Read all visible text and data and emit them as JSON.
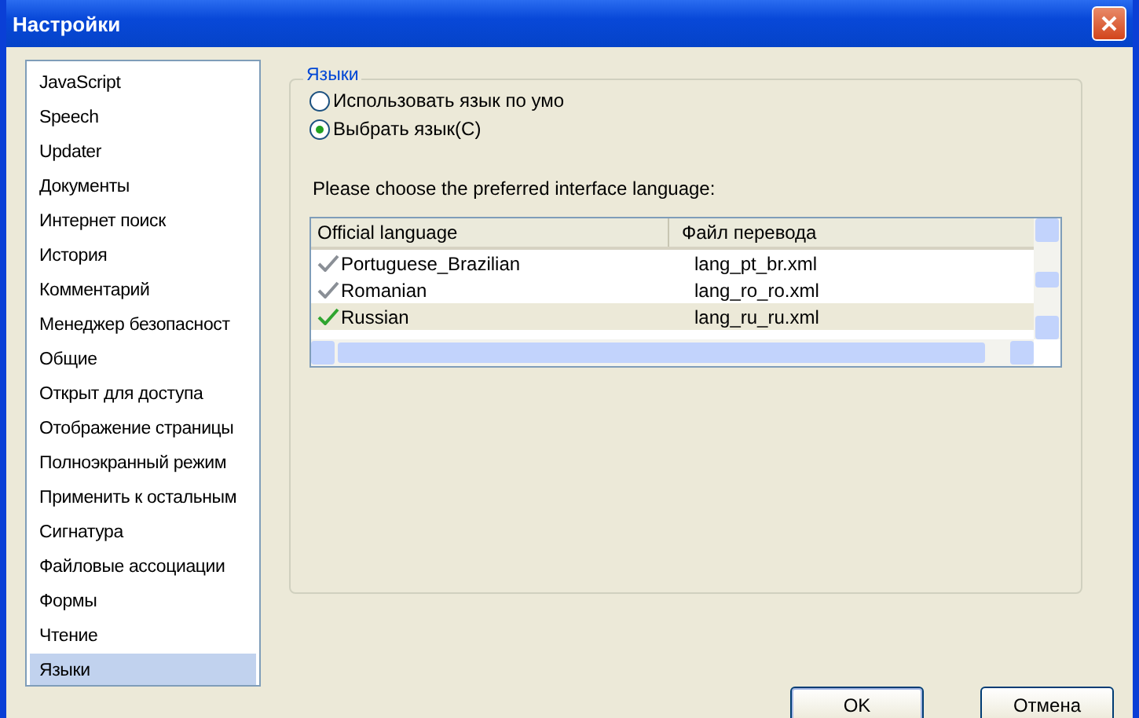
{
  "window": {
    "title": "Настройки"
  },
  "sidebar": {
    "items": [
      {
        "label": "JavaScript",
        "selected": false
      },
      {
        "label": "Speech",
        "selected": false
      },
      {
        "label": "Updater",
        "selected": false
      },
      {
        "label": "Документы",
        "selected": false
      },
      {
        "label": "Интернет поиск",
        "selected": false
      },
      {
        "label": "История",
        "selected": false
      },
      {
        "label": "Комментарий",
        "selected": false
      },
      {
        "label": "Менеджер безопасност",
        "selected": false
      },
      {
        "label": "Общие",
        "selected": false
      },
      {
        "label": "Открыт для доступа",
        "selected": false
      },
      {
        "label": "Отображение страницы",
        "selected": false
      },
      {
        "label": "Полноэкранный режим",
        "selected": false
      },
      {
        "label": "Применить к остальным",
        "selected": false
      },
      {
        "label": "Сигнатура",
        "selected": false
      },
      {
        "label": "Файловые ассоциации",
        "selected": false
      },
      {
        "label": "Формы",
        "selected": false
      },
      {
        "label": "Чтение",
        "selected": false
      },
      {
        "label": "Языки",
        "selected": true
      }
    ]
  },
  "group": {
    "legend": "Языки",
    "radios": [
      {
        "label": "Использовать язык по умо",
        "selected": false
      },
      {
        "label": "Выбрать язык(C)",
        "selected": true
      }
    ],
    "prompt": "Please choose the preferred interface language:",
    "table": {
      "columns": [
        "Official language",
        "Файл перевода"
      ],
      "rows": [
        {
          "language": "Portuguese_Brazilian",
          "file": "lang_pt_br.xml",
          "current": false,
          "selected": false
        },
        {
          "language": "Romanian",
          "file": "lang_ro_ro.xml",
          "current": false,
          "selected": false
        },
        {
          "language": "Russian",
          "file": "lang_ru_ru.xml",
          "current": true,
          "selected": true
        }
      ]
    }
  },
  "buttons": [
    "OK",
    "Отмена"
  ]
}
